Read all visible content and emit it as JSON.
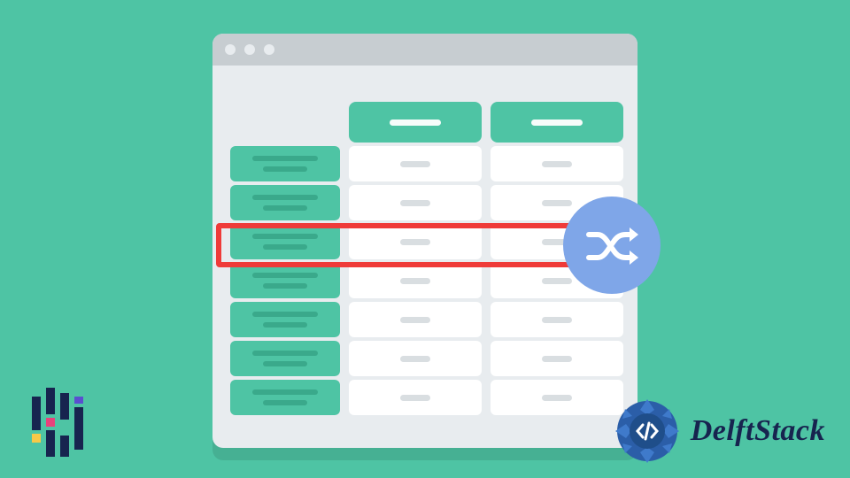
{
  "brand": {
    "name": "DelftStack"
  },
  "icons": {
    "shuffle": "shuffle-icon",
    "pandas": "pandas-logo-icon",
    "delft_badge": "delftstack-badge-icon"
  },
  "colors": {
    "background": "#4ec4a4",
    "window_bg": "#e8ecef",
    "titlebar": "#c7cdd1",
    "accent": "#4ec4a4",
    "highlight": "#ef3b39",
    "shuffle_badge": "#7fa6e8",
    "brand_text": "#17244f"
  },
  "spreadsheet": {
    "columns": 2,
    "rows": 7,
    "highlighted_row_index": 2
  }
}
